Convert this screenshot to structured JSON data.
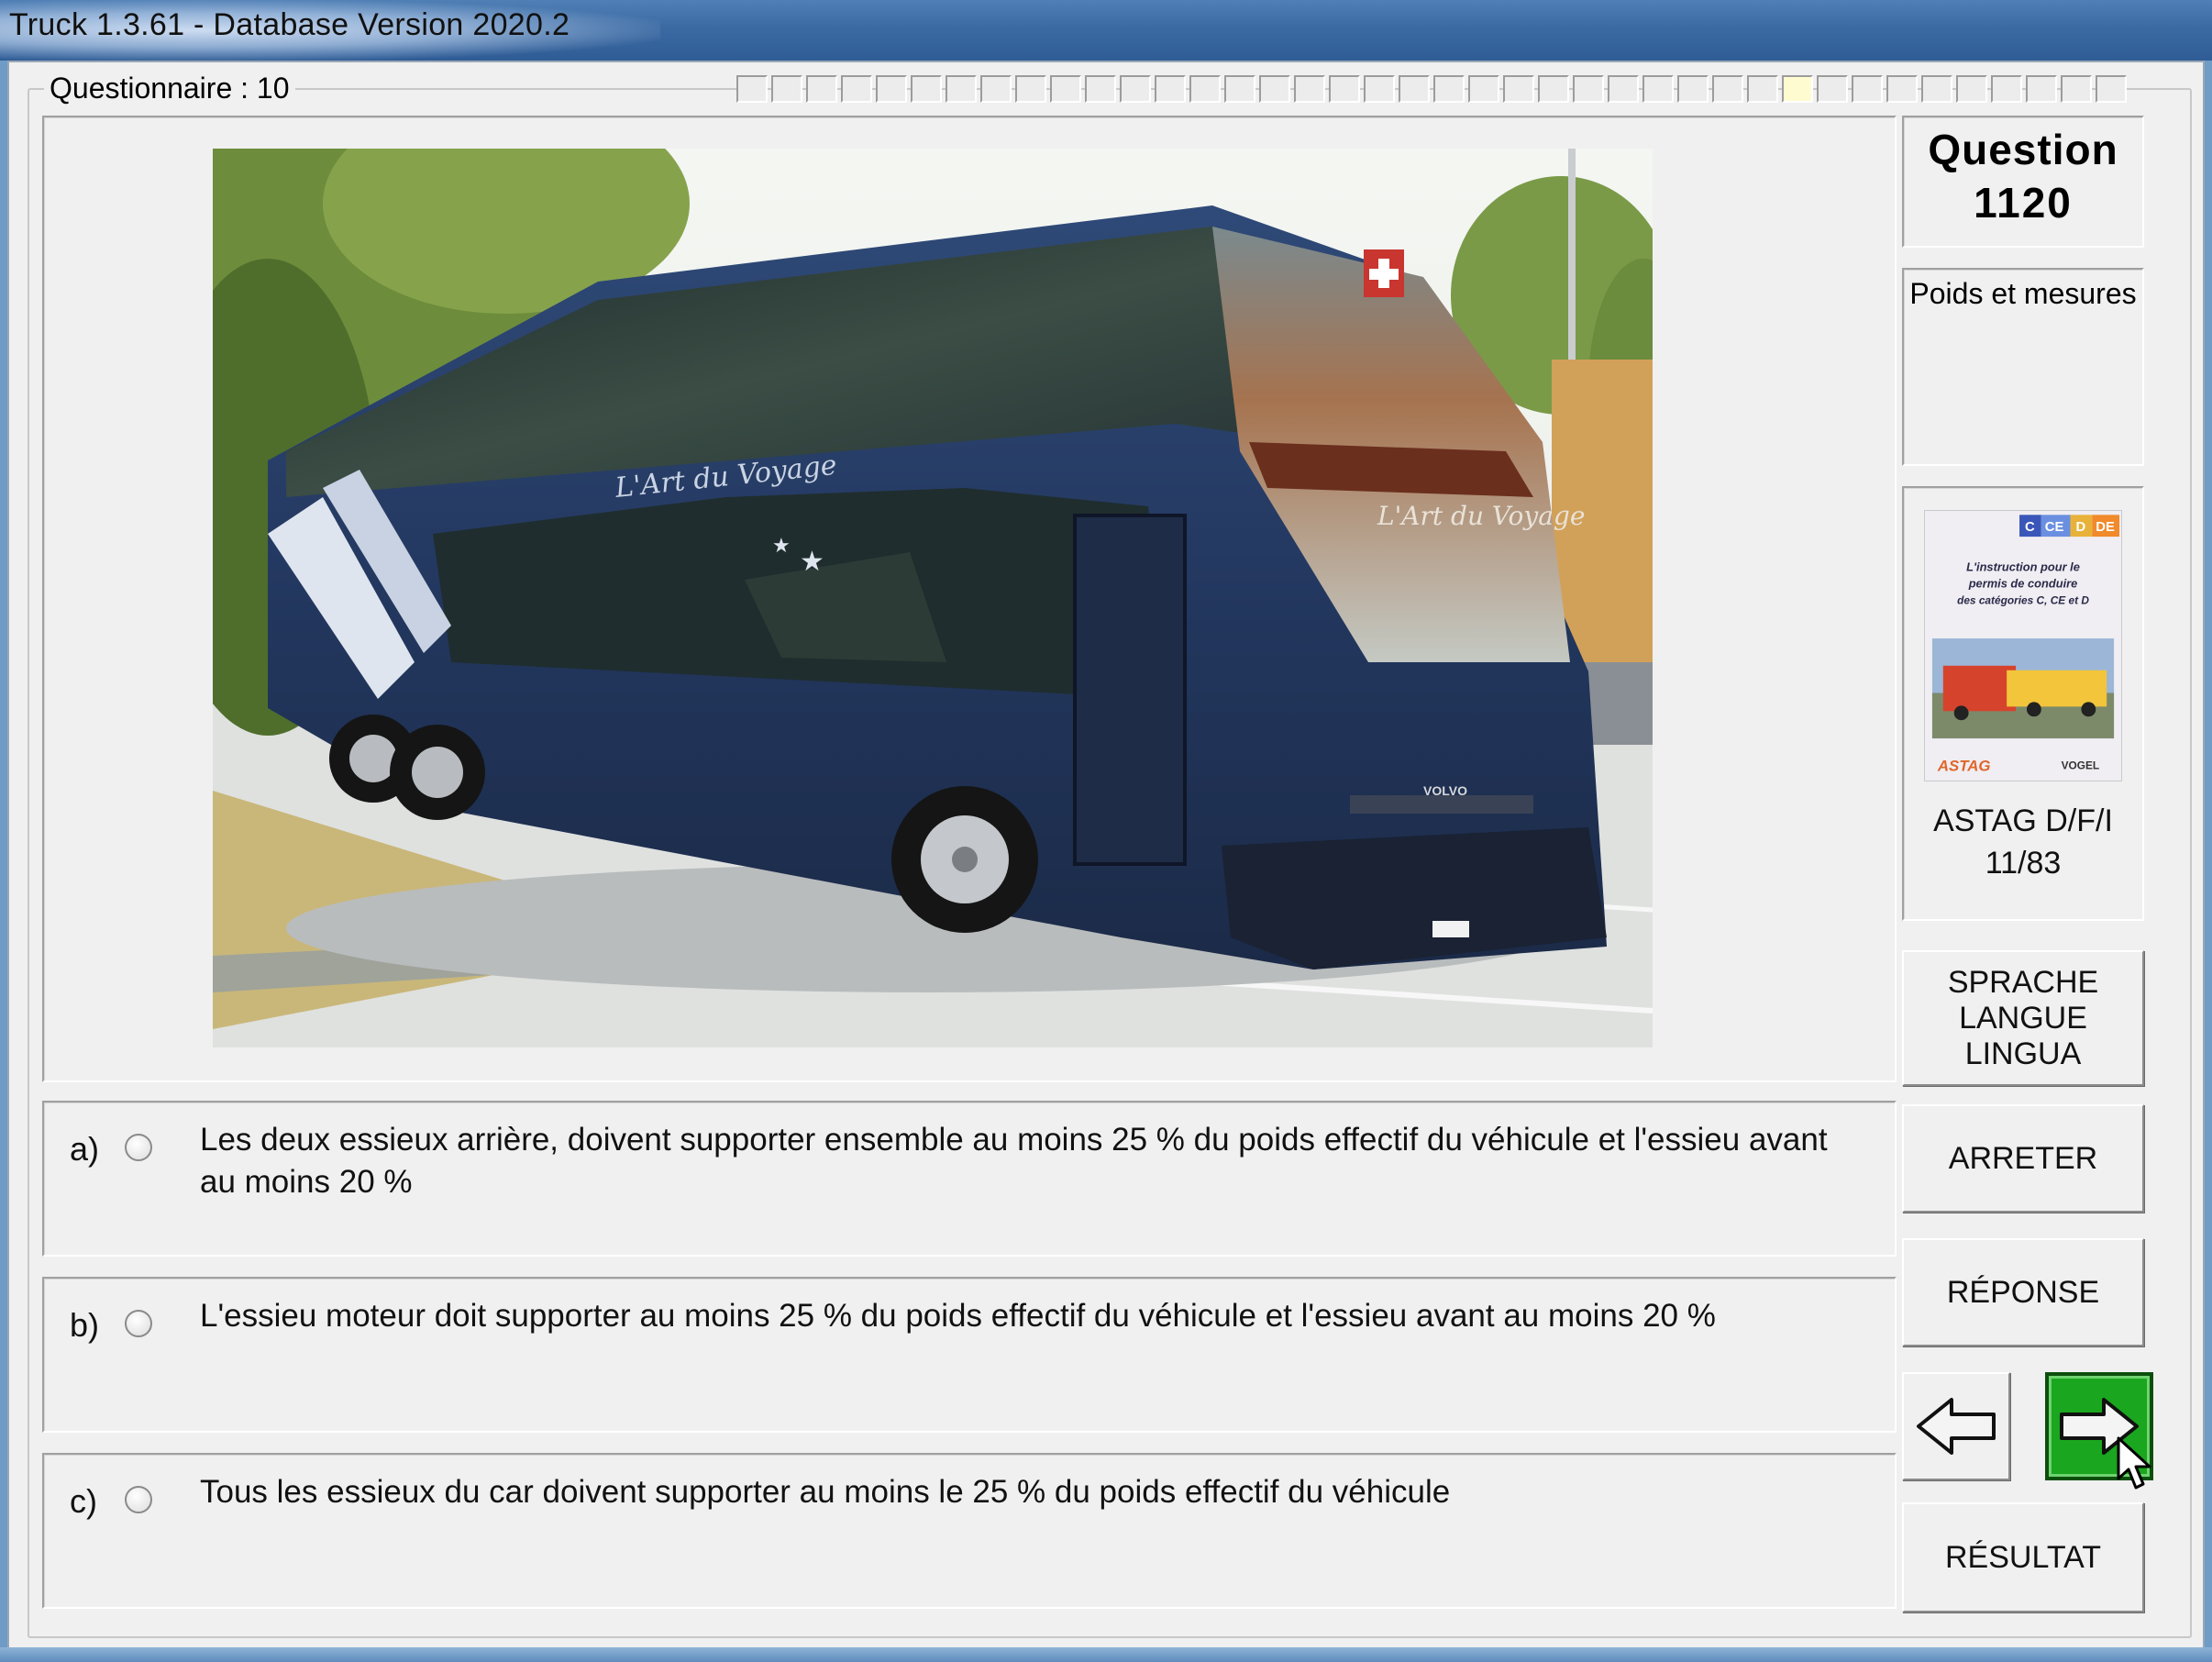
{
  "window": {
    "title": "Truck 1.3.61 - Database Version 2020.2"
  },
  "questionnaire": {
    "label": "Questionnaire : 10",
    "progress_total": 40,
    "progress_current": 31
  },
  "question": {
    "label": "Question",
    "number": "1120",
    "category": "Poids et mesures",
    "image_icon": "double-decker-coach-photo"
  },
  "source": {
    "book_icon": "astag-textbook-cover",
    "book_badges": [
      "C",
      "CE",
      "D",
      "DE"
    ],
    "book_title_lines": [
      "L'instruction pour le",
      "permis de conduire",
      "des catégories C, CE et D"
    ],
    "book_publishers": [
      "ASTAG",
      "VOGEL"
    ],
    "name": "ASTAG D/F/I",
    "page": "11/83"
  },
  "answers": [
    {
      "letter": "a)",
      "text": "Les deux essieux arrière, doivent supporter ensemble au moins 25 % du poids effectif du véhicule et l'essieu avant au moins 20 %"
    },
    {
      "letter": "b)",
      "text": "L'essieu moteur doit supporter au moins 25 % du poids effectif du véhicule et l'essieu avant au moins 20 %"
    },
    {
      "letter": "c)",
      "text": "Tous les essieux du car doivent supporter au moins le 25 % du poids effectif du véhicule"
    }
  ],
  "photo": {
    "coach_text": "L'Art du Voyage",
    "brand": "VOLVO"
  },
  "buttons": {
    "language_lines": [
      "SPRACHE",
      "LANGUE",
      "LINGUA"
    ],
    "stop": "ARRETER",
    "answer": "RÉPONSE",
    "previous_icon": "arrow-left-icon",
    "next_icon": "arrow-right-icon",
    "result": "RÉSULTAT"
  },
  "colors": {
    "next_button": "#1aa61e",
    "window_frame": "#3b6aa3"
  }
}
